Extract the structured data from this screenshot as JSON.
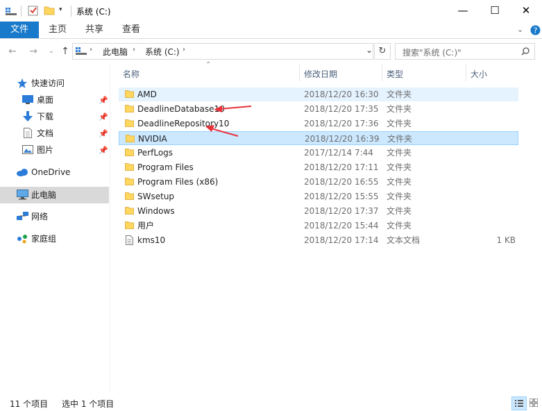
{
  "window": {
    "title": "系统 (C:)",
    "minimize_label": "—",
    "maximize_label": "☐",
    "close_label": "✕"
  },
  "ribbon": {
    "tabs": [
      "文件",
      "主页",
      "共享",
      "查看"
    ],
    "expand_icon": "chevron-down-icon",
    "help_icon": "help-icon"
  },
  "address_bar": {
    "breadcrumb": [
      "此电脑",
      "系统 (C:)"
    ],
    "search_placeholder": "搜索\"系统 (C:)\""
  },
  "sidebar": {
    "quick_access": "快速访问",
    "pinned": [
      {
        "label": "桌面",
        "icon": "desktop-icon"
      },
      {
        "label": "下载",
        "icon": "download-icon"
      },
      {
        "label": "文档",
        "icon": "document-icon"
      },
      {
        "label": "图片",
        "icon": "picture-icon"
      }
    ],
    "onedrive": "OneDrive",
    "this_pc": "此电脑",
    "network": "网络",
    "homegroup": "家庭组"
  },
  "columns": {
    "name": "名称",
    "date": "修改日期",
    "type": "类型",
    "size": "大小"
  },
  "files": [
    {
      "name": "AMD",
      "date": "2018/12/20 16:30",
      "type": "文件夹",
      "size": "",
      "kind": "folder",
      "state": "hover"
    },
    {
      "name": "DeadlineDatabase10",
      "date": "2018/12/20 17:35",
      "type": "文件夹",
      "size": "",
      "kind": "folder",
      "state": ""
    },
    {
      "name": "DeadlineRepository10",
      "date": "2018/12/20 17:36",
      "type": "文件夹",
      "size": "",
      "kind": "folder",
      "state": ""
    },
    {
      "name": "NVIDIA",
      "date": "2018/12/20 16:39",
      "type": "文件夹",
      "size": "",
      "kind": "folder",
      "state": "selected"
    },
    {
      "name": "PerfLogs",
      "date": "2017/12/14 7:44",
      "type": "文件夹",
      "size": "",
      "kind": "folder",
      "state": ""
    },
    {
      "name": "Program Files",
      "date": "2018/12/20 17:11",
      "type": "文件夹",
      "size": "",
      "kind": "folder",
      "state": ""
    },
    {
      "name": "Program Files (x86)",
      "date": "2018/12/20 16:55",
      "type": "文件夹",
      "size": "",
      "kind": "folder",
      "state": ""
    },
    {
      "name": "SWsetup",
      "date": "2018/12/20 15:55",
      "type": "文件夹",
      "size": "",
      "kind": "folder",
      "state": ""
    },
    {
      "name": "Windows",
      "date": "2018/12/20 17:37",
      "type": "文件夹",
      "size": "",
      "kind": "folder",
      "state": ""
    },
    {
      "name": "用户",
      "date": "2018/12/20 15:44",
      "type": "文件夹",
      "size": "",
      "kind": "folder",
      "state": ""
    },
    {
      "name": "kms10",
      "date": "2018/12/20 17:14",
      "type": "文本文档",
      "size": "1 KB",
      "kind": "text",
      "state": ""
    }
  ],
  "status": {
    "count": "11 个项目",
    "selection": "选中 1 个项目"
  },
  "colors": {
    "accent": "#1979ca",
    "selected_bg": "#cce8ff",
    "hover_bg": "#e5f3ff",
    "folder": "#ffd75e",
    "annotation_arrow": "#e8323a"
  }
}
